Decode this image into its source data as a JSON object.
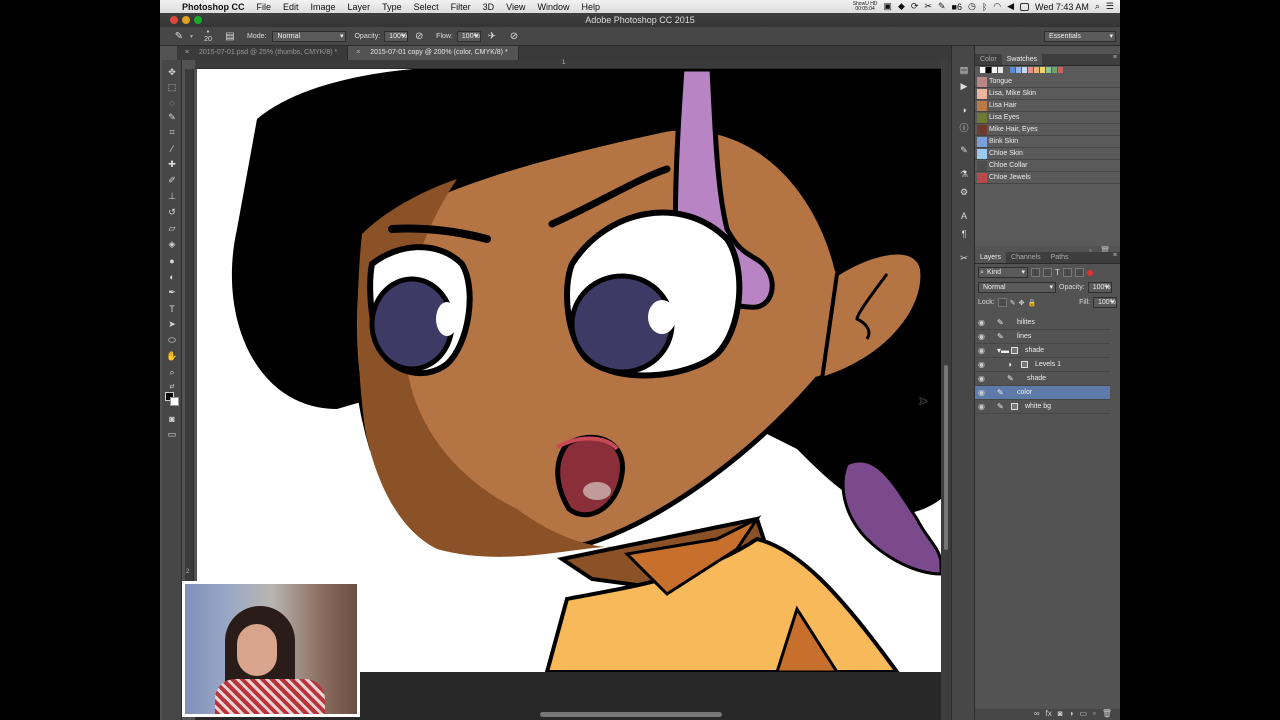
{
  "menubar": {
    "app_name": "Photoshop CC",
    "items": [
      "File",
      "Edit",
      "Image",
      "Layer",
      "Type",
      "Select",
      "Filter",
      "3D",
      "View",
      "Window",
      "Help"
    ],
    "status_text": "ShowU HD",
    "status_time_small": "00:05:04",
    "badge_count": "6",
    "clock": "Wed 7:43 AM"
  },
  "titlebar": {
    "title": "Adobe Photoshop CC 2015"
  },
  "options": {
    "brush_size": "20",
    "mode_label": "Mode:",
    "mode_value": "Normal",
    "opacity_label": "Opacity:",
    "opacity_value": "100%",
    "flow_label": "Flow:",
    "flow_value": "100%",
    "workspace": "Essentials"
  },
  "tabs": [
    {
      "label": "2015-07-01.psd @ 25% (thumbs, CMYK/8) *",
      "active": false
    },
    {
      "label": "2015-07-01 copy @ 200% (color, CMYK/8) *",
      "active": true
    }
  ],
  "rulers": {
    "top_mark": "1",
    "left_mark": "2"
  },
  "swatches_panel": {
    "tabs": [
      "Color",
      "Swatches"
    ],
    "active_tab": "Swatches",
    "top_colors": [
      "#ffffff",
      "#000000",
      "#f4f4f4",
      "#e6e6e6",
      "#5b8dd6",
      "#8fb3e8",
      "#c8d7ee",
      "#e58f8f",
      "#e8b07a",
      "#f1d36b",
      "#8fc58f",
      "#6aa56a",
      "#d15f5f"
    ],
    "items": [
      {
        "name": "Tongue",
        "color": "#b98787"
      },
      {
        "name": "Lisa, Mike Skin",
        "color": "#efb5a0"
      },
      {
        "name": "Lisa Hair",
        "color": "#b97a4a"
      },
      {
        "name": "Lisa Eyes",
        "color": "#6e7a33"
      },
      {
        "name": "Mike Hair, Eyes",
        "color": "#6e3a2e"
      },
      {
        "name": "Bink Skin",
        "color": "#7b9fd6"
      },
      {
        "name": "Chloe Skin",
        "color": "#9fc8f0"
      },
      {
        "name": "Chloe Collar",
        "color": "#4d4d4d"
      },
      {
        "name": "Chloe Jewels",
        "color": "#b84a4a"
      }
    ]
  },
  "layers_panel": {
    "tabs": [
      "Layers",
      "Channels",
      "Paths"
    ],
    "active_tab": "Layers",
    "filter_kind": "Kind",
    "blend_mode": "Normal",
    "opacity_label": "Opacity:",
    "opacity_value": "100%",
    "lock_label": "Lock:",
    "fill_label": "Fill:",
    "fill_value": "100%",
    "layers": [
      {
        "name": "hilites",
        "kind": "brush",
        "indent": 0,
        "selected": false
      },
      {
        "name": "lines",
        "kind": "brush",
        "indent": 0,
        "selected": false
      },
      {
        "name": "shade",
        "kind": "group",
        "indent": 0,
        "selected": false
      },
      {
        "name": "Levels 1",
        "kind": "adjustment",
        "indent": 1,
        "selected": false
      },
      {
        "name": "shade",
        "kind": "brush",
        "indent": 1,
        "selected": false
      },
      {
        "name": "color",
        "kind": "brush",
        "indent": 0,
        "selected": true
      },
      {
        "name": "white bg",
        "kind": "brush",
        "indent": 0,
        "selected": false
      }
    ]
  },
  "colors": {
    "skin": "#b47443",
    "skin_shadow": "#8a5226",
    "hair": "#000000",
    "hair_pink": "#b884c4",
    "hair_purple": "#7a4a8c",
    "iris": "#3d3a66",
    "mouth_inner": "#8a2e3a",
    "shirt": "#f7b95a",
    "shirt_shadow": "#c7702e",
    "selected_layer": "#5d7aa8"
  }
}
